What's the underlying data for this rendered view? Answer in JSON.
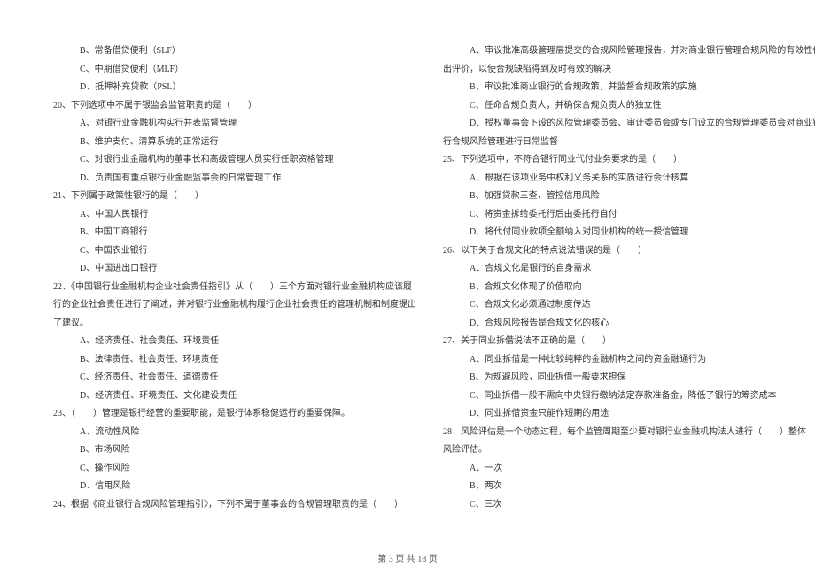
{
  "left": {
    "opt_b_19": "B、常备借贷便利（SLF）",
    "opt_c_19": "C、中期借贷便利（MLF）",
    "opt_d_19": "D、抵押补充贷款（PSL）",
    "q20": "20、下列选项中不属于银监会监管职责的是（　　）",
    "q20_a": "A、对银行业金融机构实行并表监督管理",
    "q20_b": "B、维护支付、清算系统的正常运行",
    "q20_c": "C、对银行业金融机构的董事长和高级管理人员实行任职资格管理",
    "q20_d": "D、负责国有重点银行业金融监事会的日常管理工作",
    "q21": "21、下列属于政策性银行的是（　　）",
    "q21_a": "A、中国人民银行",
    "q21_b": "B、中国工商银行",
    "q21_c": "C、中国农业银行",
    "q21_d": "D、中国进出口银行",
    "q22_line1": "22、《中国银行业金融机构企业社会责任指引》从（　　）三个方面对银行业金融机构应该履",
    "q22_line2": "行的企业社会责任进行了阐述，并对银行业金融机构履行企业社会责任的管理机制和制度提出",
    "q22_line3": "了建议。",
    "q22_a": "A、经济责任、社会责任、环境责任",
    "q22_b": "B、法律责任、社会责任、环境责任",
    "q22_c": "C、经济责任、社会责任、道德责任",
    "q22_d": "D、经济责任、环境责任、文化建设责任",
    "q23": "23、（　　）管理是银行经营的重要职能，是银行体系稳健运行的重要保障。",
    "q23_a": "A、流动性风险",
    "q23_b": "B、市场风险",
    "q23_c": "C、操作风险",
    "q23_d": "D、信用风险",
    "q24": "24、根据《商业银行合规风险管理指引》，下列不属于董事会的合规管理职责的是（　　）"
  },
  "right": {
    "q24_a_line1": "A、审议批准高级管理层提交的合规风险管理报告，并对商业银行管理合规风险的有效性作",
    "q24_a_line2": "出评价，以使合规缺陷得到及时有效的解决",
    "q24_b": "B、审议批准商业银行的合规政策，并监督合规政策的实施",
    "q24_c": "C、任命合规负责人，并确保合规负责人的独立性",
    "q24_d_line1": "D、授权董事会下设的风险管理委员会、审计委员会或专门设立的合规管理委员会对商业银",
    "q24_d_line2": "行合规风险管理进行日常监督",
    "q25": "25、下列选项中，不符合银行同业代付业务要求的是（　　）",
    "q25_a": "A、根据在该项业务中权利义务关系的实质进行会计核算",
    "q25_b": "B、加强贷款三查，管控信用风险",
    "q25_c": "C、将资金拆给委托行后由委托行自付",
    "q25_d": "D、将代付同业款项全额纳入对同业机构的统一授信管理",
    "q26": "26、以下关于合规文化的特点说法错误的是（　　）",
    "q26_a": "A、合规文化是银行的自身需求",
    "q26_b": "B、合规文化体现了价值取向",
    "q26_c": "C、合规文化必须通过制度传达",
    "q26_d": "D、合规风险报告是合规文化的核心",
    "q27": "27、关于同业拆借说法不正确的是（　　）",
    "q27_a": "A、同业拆借是一种比较纯粹的金融机构之间的资金融通行为",
    "q27_b": "B、为规避风险，同业拆借一般要求担保",
    "q27_c": "C、同业拆借一般不需向中央银行缴纳法定存款准备金，降低了银行的筹资成本",
    "q27_d": "D、同业拆借资金只能作短期的用途",
    "q28_line1": "28、风险评估是一个动态过程，每个监管周期至少要对银行业金融机构法人进行（　　）整体",
    "q28_line2": "风险评估。",
    "q28_a": "A、一次",
    "q28_b": "B、两次",
    "q28_c": "C、三次"
  },
  "footer": "第 3 页 共 18 页"
}
